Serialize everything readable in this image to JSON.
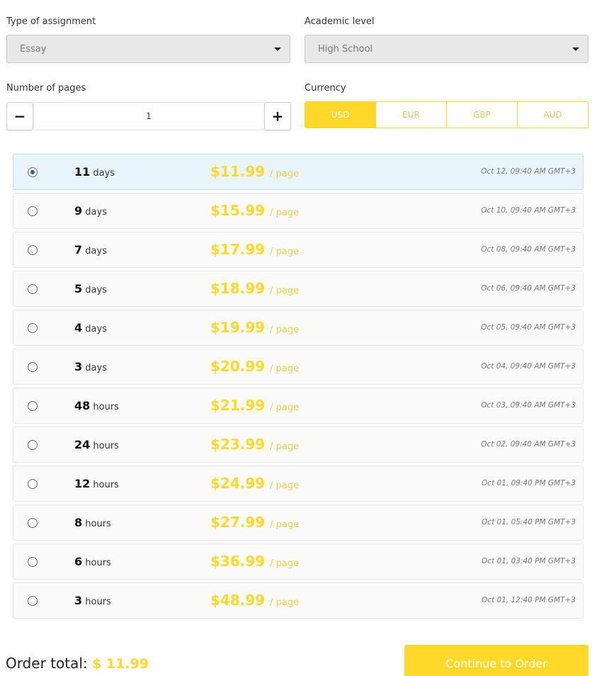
{
  "form": {
    "assignment_label": "Type of assignment",
    "assignment_value": "Essay",
    "level_label": "Academic level",
    "level_value": "High School",
    "pages_label": "Number of pages",
    "pages_minus": "−",
    "pages_value": "1",
    "pages_plus": "+",
    "currency_label": "Currency",
    "currencies": [
      "USD",
      "EUR",
      "GBP",
      "AUD"
    ],
    "selected_currency": "USD"
  },
  "deadlines": [
    {
      "num": "11",
      "unit": "days",
      "price": "$11.99",
      "per": "/ page",
      "date": "Oct 12, 09:40 AM GMT+3",
      "selected": true
    },
    {
      "num": "9",
      "unit": "days",
      "price": "$15.99",
      "per": "/ page",
      "date": "Oct 10, 09:40 AM GMT+3",
      "selected": false
    },
    {
      "num": "7",
      "unit": "days",
      "price": "$17.99",
      "per": "/ page",
      "date": "Oct 08, 09:40 AM GMT+3",
      "selected": false
    },
    {
      "num": "5",
      "unit": "days",
      "price": "$18.99",
      "per": "/ page",
      "date": "Oct 06, 09:40 AM GMT+3",
      "selected": false
    },
    {
      "num": "4",
      "unit": "days",
      "price": "$19.99",
      "per": "/ page",
      "date": "Oct 05, 09:40 AM GMT+3",
      "selected": false
    },
    {
      "num": "3",
      "unit": "days",
      "price": "$20.99",
      "per": "/ page",
      "date": "Oct 04, 09:40 AM GMT+3",
      "selected": false
    },
    {
      "num": "48",
      "unit": "hours",
      "price": "$21.99",
      "per": "/ page",
      "date": "Oct 03, 09:40 AM GMT+3",
      "selected": false
    },
    {
      "num": "24",
      "unit": "hours",
      "price": "$23.99",
      "per": "/ page",
      "date": "Oct 02, 09:40 AM GMT+3",
      "selected": false
    },
    {
      "num": "12",
      "unit": "hours",
      "price": "$24.99",
      "per": "/ page",
      "date": "Oct 01, 09:40 PM GMT+3",
      "selected": false
    },
    {
      "num": "8",
      "unit": "hours",
      "price": "$27.99",
      "per": "/ page",
      "date": "Oct 01, 05:40 PM GMT+3",
      "selected": false
    },
    {
      "num": "6",
      "unit": "hours",
      "price": "$36.99",
      "per": "/ page",
      "date": "Oct 01, 03:40 PM GMT+3",
      "selected": false
    },
    {
      "num": "3",
      "unit": "hours",
      "price": "$48.99",
      "per": "/ page",
      "date": "Oct 01, 12:40 PM GMT+3",
      "selected": false
    }
  ],
  "footer": {
    "total_label": "Order total:",
    "total_value": "$ 11.99",
    "cta_label": "Continue to Order"
  },
  "colors": {
    "accent": "#FFD828",
    "selected_row": "#e9f5fd",
    "radio_dot": "#2b5fa8"
  },
  "icons": {
    "select_caret": "chevron-down-icon"
  }
}
